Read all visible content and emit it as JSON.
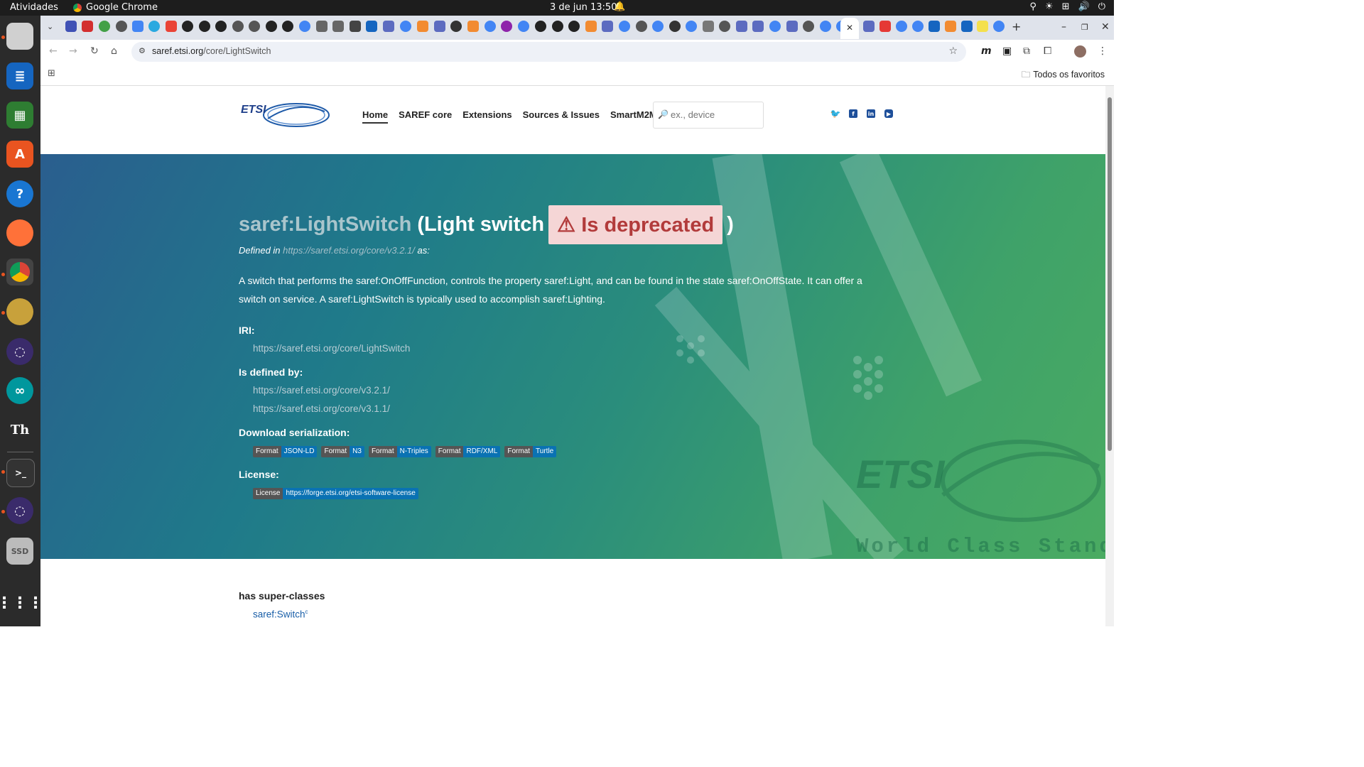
{
  "topbar": {
    "activities": "Atividades",
    "app_name": "Google Chrome",
    "clock": "3 de jun  13:50"
  },
  "browser": {
    "url_host": "saref.etsi.org",
    "url_path": "/core/LightSwitch",
    "bookmarks_label": "Todos os favoritos"
  },
  "site": {
    "nav": [
      "Home",
      "SAREF core",
      "Extensions",
      "Sources & Issues",
      "SmartM2M"
    ],
    "search_placeholder": "ex., device",
    "logo_text": "ETSI"
  },
  "hero": {
    "qname": "saref:LightSwitch",
    "label_open": "(Light switch",
    "deprecated": "⚠ Is deprecated",
    "label_close": ")",
    "defined_prefix": "Defined in",
    "defined_link": "https://saref.etsi.org/core/v3.2.1/",
    "defined_suffix": "as:",
    "description": "A switch that performs the saref:OnOffFunction, controls the property saref:Light, and can be found in the state saref:OnOffState. It can offer a switch on service. A saref:LightSwitch is typically used to accomplish saref:Lighting.",
    "iri_label": "IRI:",
    "iri": "https://saref.etsi.org/core/LightSwitch",
    "defined_by_label": "Is defined by:",
    "defined_by": [
      "https://saref.etsi.org/core/v3.2.1/",
      "https://saref.etsi.org/core/v3.1.1/"
    ],
    "download_label": "Download serialization:",
    "formats": [
      {
        "key": "Format",
        "value": "JSON-LD"
      },
      {
        "key": "Format",
        "value": "N3"
      },
      {
        "key": "Format",
        "value": "N-Triples"
      },
      {
        "key": "Format",
        "value": "RDF/XML"
      },
      {
        "key": "Format",
        "value": "Turtle"
      }
    ],
    "license_label": "License:",
    "license_key": "License",
    "license_value": "https://forge.etsi.org/etsi-software-license",
    "watermark": "World Class Standar"
  },
  "body": {
    "superclasses_label": "has super-classes",
    "superclass": "saref:Switch",
    "superclass_sup": "c"
  },
  "colors": {
    "deprecated_bg": "#f5d6d6",
    "deprecated_text": "#b23b3b",
    "badge_value": "#0a72b3",
    "link": "#1a5fa8"
  }
}
